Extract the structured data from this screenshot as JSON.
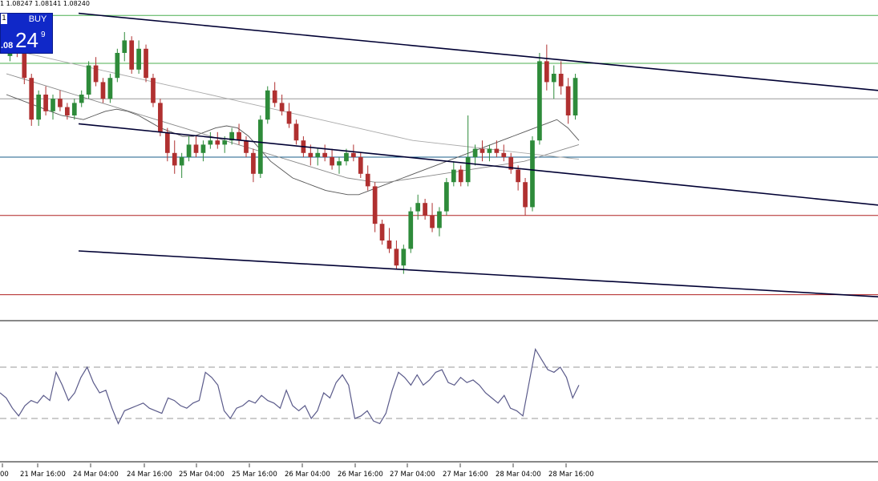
{
  "header": {
    "ohlc_text": "1 1.08247 1.08141 1.08240"
  },
  "trade_panel": {
    "buy_label": "BUY",
    "mini_label": "1",
    "price_small": ".08",
    "price_big": "24",
    "price_sup": "9"
  },
  "colors": {
    "background": "#ffffff",
    "trade_panel": "#1028c8",
    "candle_up": "#2e8b3a",
    "candle_down": "#b03030",
    "trendline": "#000033",
    "level_green": "#4caf50",
    "level_blue": "#1a5e8a",
    "level_red": "#b02020",
    "level_gray": "#999999",
    "rsi_line": "#5a5a8a"
  },
  "chart_data": [
    {
      "type": "candlestick",
      "title": "",
      "x_tick_labels": [
        "00",
        "21 Mar 16:00",
        "24 Mar 04:00",
        "24 Mar 16:00",
        "25 Mar 04:00",
        "25 Mar 16:00",
        "26 Mar 04:00",
        "26 Mar 16:00",
        "27 Mar 04:00",
        "27 Mar 16:00",
        "28 Mar 04:00",
        "28 Mar 16:00"
      ],
      "x_tick_positions": [
        3,
        47,
        113,
        180,
        245,
        311,
        377,
        443,
        508,
        574,
        640,
        706
      ],
      "y_range": [
        0,
        1
      ],
      "candles": [
        [
          0.885,
          0.96,
          0.86,
          0.92
        ],
        [
          0.92,
          0.97,
          0.88,
          0.9
        ],
        [
          0.9,
          0.92,
          0.75,
          0.78
        ],
        [
          0.78,
          0.8,
          0.55,
          0.58
        ],
        [
          0.58,
          0.72,
          0.55,
          0.7
        ],
        [
          0.7,
          0.74,
          0.6,
          0.62
        ],
        [
          0.62,
          0.7,
          0.58,
          0.68
        ],
        [
          0.68,
          0.72,
          0.62,
          0.64
        ],
        [
          0.64,
          0.66,
          0.58,
          0.6
        ],
        [
          0.6,
          0.68,
          0.58,
          0.66
        ],
        [
          0.66,
          0.72,
          0.64,
          0.7
        ],
        [
          0.7,
          0.86,
          0.68,
          0.84
        ],
        [
          0.84,
          0.88,
          0.74,
          0.76
        ],
        [
          0.76,
          0.78,
          0.66,
          0.68
        ],
        [
          0.68,
          0.8,
          0.66,
          0.78
        ],
        [
          0.78,
          0.92,
          0.76,
          0.9
        ],
        [
          0.9,
          1.0,
          0.86,
          0.96
        ],
        [
          0.96,
          0.98,
          0.8,
          0.82
        ],
        [
          0.82,
          0.96,
          0.8,
          0.92
        ],
        [
          0.92,
          0.94,
          0.76,
          0.78
        ],
        [
          0.78,
          0.8,
          0.64,
          0.66
        ],
        [
          0.66,
          0.68,
          0.5,
          0.52
        ],
        [
          0.52,
          0.54,
          0.38,
          0.42
        ],
        [
          0.42,
          0.48,
          0.32,
          0.36
        ],
        [
          0.36,
          0.42,
          0.3,
          0.4
        ],
        [
          0.4,
          0.5,
          0.38,
          0.46
        ],
        [
          0.46,
          0.5,
          0.4,
          0.42
        ],
        [
          0.42,
          0.48,
          0.38,
          0.46
        ],
        [
          0.46,
          0.52,
          0.44,
          0.48
        ],
        [
          0.48,
          0.52,
          0.44,
          0.46
        ],
        [
          0.46,
          0.5,
          0.42,
          0.48
        ],
        [
          0.48,
          0.54,
          0.46,
          0.52
        ],
        [
          0.52,
          0.56,
          0.46,
          0.48
        ],
        [
          0.48,
          0.5,
          0.4,
          0.42
        ],
        [
          0.42,
          0.44,
          0.28,
          0.32
        ],
        [
          0.32,
          0.6,
          0.3,
          0.58
        ],
        [
          0.58,
          0.74,
          0.56,
          0.72
        ],
        [
          0.72,
          0.76,
          0.64,
          0.66
        ],
        [
          0.66,
          0.7,
          0.6,
          0.62
        ],
        [
          0.62,
          0.66,
          0.54,
          0.56
        ],
        [
          0.56,
          0.58,
          0.46,
          0.48
        ],
        [
          0.48,
          0.5,
          0.4,
          0.42
        ],
        [
          0.42,
          0.46,
          0.36,
          0.4
        ],
        [
          0.4,
          0.44,
          0.36,
          0.42
        ],
        [
          0.42,
          0.46,
          0.38,
          0.4
        ],
        [
          0.4,
          0.44,
          0.34,
          0.36
        ],
        [
          0.36,
          0.4,
          0.32,
          0.38
        ],
        [
          0.38,
          0.44,
          0.36,
          0.42
        ],
        [
          0.42,
          0.46,
          0.38,
          0.4
        ],
        [
          0.4,
          0.42,
          0.3,
          0.32
        ],
        [
          0.32,
          0.36,
          0.24,
          0.26
        ],
        [
          0.26,
          0.28,
          0.04,
          0.08
        ],
        [
          0.08,
          0.1,
          -0.02,
          0.0
        ],
        [
          0.0,
          0.06,
          -0.06,
          -0.04
        ],
        [
          -0.04,
          0.0,
          -0.14,
          -0.12
        ],
        [
          -0.12,
          -0.02,
          -0.16,
          -0.04
        ],
        [
          -0.04,
          0.16,
          -0.06,
          0.14
        ],
        [
          0.14,
          0.22,
          0.1,
          0.18
        ],
        [
          0.18,
          0.2,
          0.1,
          0.12
        ],
        [
          0.12,
          0.18,
          0.04,
          0.06
        ],
        [
          0.06,
          0.16,
          0.02,
          0.14
        ],
        [
          0.14,
          0.3,
          0.12,
          0.28
        ],
        [
          0.28,
          0.38,
          0.26,
          0.34
        ],
        [
          0.34,
          0.36,
          0.26,
          0.28
        ],
        [
          0.28,
          0.6,
          0.26,
          0.4
        ],
        [
          0.4,
          0.46,
          0.36,
          0.44
        ],
        [
          0.44,
          0.48,
          0.38,
          0.42
        ],
        [
          0.42,
          0.46,
          0.38,
          0.44
        ],
        [
          0.44,
          0.48,
          0.4,
          0.42
        ],
        [
          0.42,
          0.46,
          0.38,
          0.4
        ],
        [
          0.4,
          0.42,
          0.32,
          0.34
        ],
        [
          0.34,
          0.36,
          0.24,
          0.28
        ],
        [
          0.28,
          0.3,
          0.12,
          0.16
        ],
        [
          0.16,
          0.5,
          0.14,
          0.48
        ],
        [
          0.48,
          0.9,
          0.46,
          0.86
        ],
        [
          0.86,
          0.94,
          0.72,
          0.76
        ],
        [
          0.76,
          0.84,
          0.68,
          0.8
        ],
        [
          0.8,
          0.86,
          0.7,
          0.74
        ],
        [
          0.74,
          0.78,
          0.56,
          0.6
        ],
        [
          0.6,
          0.8,
          0.58,
          0.78
        ]
      ],
      "moving_averages": [
        {
          "values": [
            0.7,
            0.68,
            0.66,
            0.64,
            0.62,
            0.6,
            0.59,
            0.58,
            0.6,
            0.62,
            0.63,
            0.62,
            0.6,
            0.57,
            0.54,
            0.52,
            0.5,
            0.5,
            0.52,
            0.54,
            0.55,
            0.54,
            0.5,
            0.44,
            0.38,
            0.34,
            0.3,
            0.28,
            0.26,
            0.24,
            0.23,
            0.22,
            0.22,
            0.24,
            0.26,
            0.28,
            0.3,
            0.32,
            0.34,
            0.36,
            0.38,
            0.4,
            0.42,
            0.44,
            0.46,
            0.48,
            0.5,
            0.52,
            0.54,
            0.56,
            0.58,
            0.54,
            0.48
          ]
        },
        {
          "values": [
            0.8,
            0.78,
            0.76,
            0.74,
            0.72,
            0.7,
            0.68,
            0.66,
            0.64,
            0.62,
            0.6,
            0.58,
            0.56,
            0.54,
            0.52,
            0.5,
            0.48,
            0.46,
            0.44,
            0.42,
            0.4,
            0.38,
            0.36,
            0.34,
            0.32,
            0.3,
            0.29,
            0.28,
            0.28,
            0.29,
            0.3,
            0.31,
            0.32,
            0.33,
            0.34,
            0.35,
            0.36,
            0.37,
            0.38,
            0.4,
            0.42,
            0.44,
            0.46
          ]
        },
        {
          "values": [
            0.92,
            0.9,
            0.88,
            0.86,
            0.84,
            0.82,
            0.8,
            0.78,
            0.76,
            0.74,
            0.72,
            0.7,
            0.68,
            0.66,
            0.64,
            0.62,
            0.6,
            0.58,
            0.56,
            0.54,
            0.52,
            0.5,
            0.48,
            0.47,
            0.46,
            0.45,
            0.44,
            0.43,
            0.42,
            0.41,
            0.4,
            0.39
          ]
        }
      ],
      "horizontal_levels": [
        {
          "y": 1.08,
          "color": "green"
        },
        {
          "y": 0.85,
          "color": "green"
        },
        {
          "y": 0.68,
          "color": "gray"
        },
        {
          "y": 0.4,
          "color": "blue"
        },
        {
          "y": 0.12,
          "color": "red"
        },
        {
          "y": -0.26,
          "color": "red"
        }
      ],
      "trendlines": [
        {
          "from": [
            0,
            1.09
          ],
          "to": [
            1,
            0.72
          ]
        },
        {
          "from": [
            0,
            0.56
          ],
          "to": [
            1,
            0.17
          ]
        },
        {
          "from": [
            0,
            -0.05
          ],
          "to": [
            1,
            -0.27
          ]
        }
      ]
    },
    {
      "type": "line",
      "title": "",
      "y_range": [
        0,
        100
      ],
      "reference_levels": [
        70,
        30
      ],
      "values": [
        50,
        46,
        38,
        32,
        40,
        44,
        42,
        48,
        44,
        66,
        56,
        44,
        50,
        62,
        70,
        58,
        50,
        52,
        38,
        26,
        36,
        38,
        40,
        42,
        38,
        36,
        34,
        46,
        44,
        40,
        38,
        42,
        44,
        66,
        62,
        56,
        36,
        30,
        38,
        40,
        44,
        42,
        48,
        44,
        42,
        38,
        52,
        40,
        36,
        40,
        30,
        36,
        50,
        46,
        58,
        64,
        56,
        30,
        32,
        36,
        28,
        26,
        34,
        52,
        66,
        62,
        56,
        64,
        56,
        60,
        66,
        68,
        58,
        56,
        62,
        58,
        60,
        56,
        50,
        46,
        42,
        48,
        38,
        36,
        32,
        58,
        84,
        76,
        68,
        66,
        70,
        62,
        46,
        56
      ]
    }
  ]
}
